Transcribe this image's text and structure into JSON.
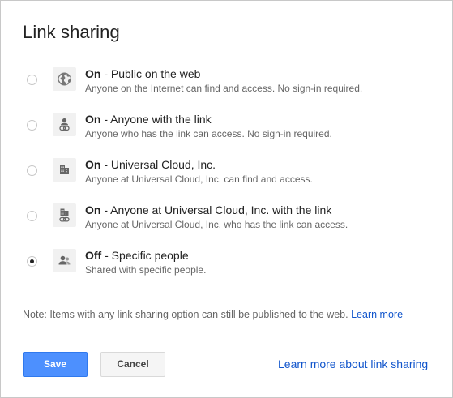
{
  "dialog": {
    "title": "Link sharing"
  },
  "options": [
    {
      "bold": "On",
      "label": " - Public on the web",
      "description": "Anyone on the Internet can find and access. No sign-in required.",
      "icon": "globe-icon",
      "checked": false
    },
    {
      "bold": "On",
      "label": " - Anyone with the link",
      "description": "Anyone who has the link can access. No sign-in required.",
      "icon": "person-link-icon",
      "checked": false
    },
    {
      "bold": "On",
      "label": " - Universal Cloud, Inc.",
      "description": "Anyone at Universal Cloud, Inc. can find and access.",
      "icon": "building-icon",
      "checked": false
    },
    {
      "bold": "On",
      "label": " - Anyone at Universal Cloud, Inc. with the link",
      "description": "Anyone at Universal Cloud, Inc. who has the link can access.",
      "icon": "building-link-icon",
      "checked": false
    },
    {
      "bold": "Off",
      "label": " - Specific people",
      "description": "Shared with specific people.",
      "icon": "people-icon",
      "checked": true
    }
  ],
  "note": {
    "text": "Note: Items with any link sharing option can still be published to the web. ",
    "link": "Learn more"
  },
  "buttons": {
    "save": "Save",
    "cancel": "Cancel"
  },
  "footer": {
    "learn_more": "Learn more about link sharing"
  },
  "colors": {
    "accent": "#4d90fe",
    "link": "#1155cc"
  }
}
